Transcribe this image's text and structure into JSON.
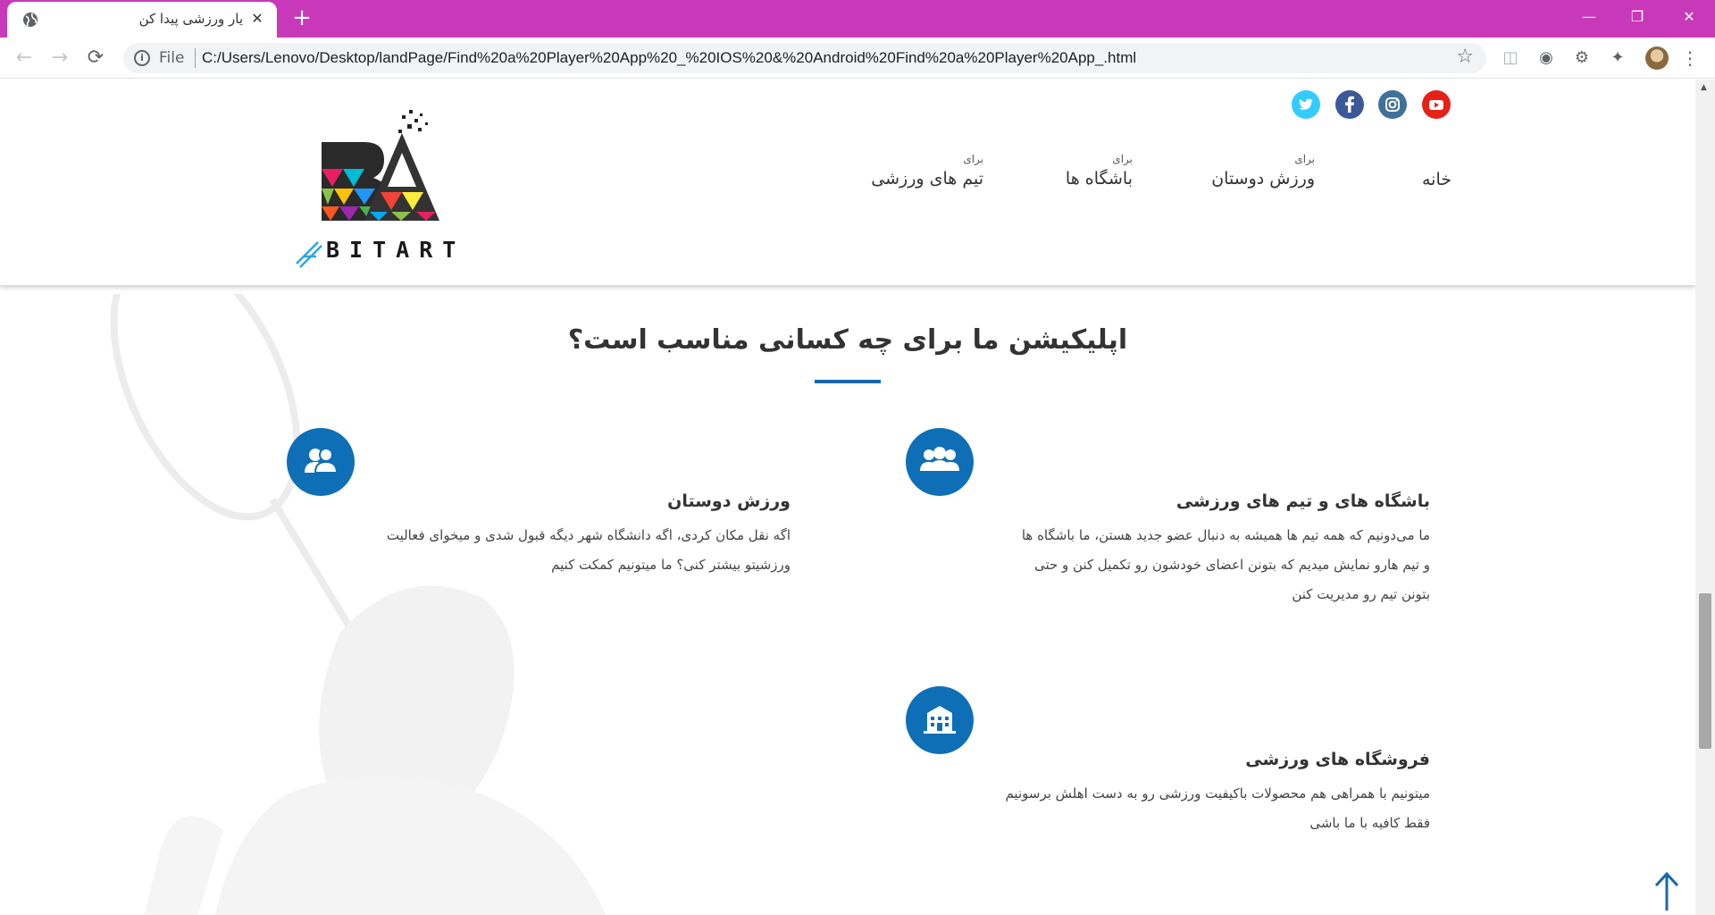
{
  "browser": {
    "tab_title": "یار ورزشی پیدا کن",
    "tab_close": "✕",
    "new_tab": "+",
    "win_minimize": "—",
    "win_restore": "❐",
    "win_close": "✕",
    "back": "←",
    "forward": "→",
    "reload": "⟳",
    "info_glyph": "i",
    "scheme": "File",
    "url": "C:/Users/Lenovo/Desktop/landPage/Find%20a%20Player%20App%20_%20IOS%20&%20Android%20Find%20a%20Player%20App_.html",
    "star": "☆",
    "extensions": [
      "◫",
      "◉",
      "⚙",
      "✦"
    ],
    "menu": "⋮",
    "icons": [
      "globe-icon",
      "info-icon",
      "star-icon",
      "camera-icon",
      "screenshot-icon",
      "extension-icon",
      "puzzle-icon",
      "profile-avatar",
      "kebab-menu-icon"
    ]
  },
  "header": {
    "social": [
      {
        "name": "youtube",
        "color": "#e62117"
      },
      {
        "name": "instagram",
        "color": "#3f729b"
      },
      {
        "name": "facebook",
        "color": "#3b5998"
      },
      {
        "name": "twitter",
        "color": "#33ccff"
      }
    ],
    "nav": [
      {
        "small": "",
        "label": "خانه"
      },
      {
        "small": "برای",
        "label": "ورزش دوستان"
      },
      {
        "small": "برای",
        "label": "باشگاه ها"
      },
      {
        "small": "برای",
        "label": "تیم های ورزشی"
      }
    ],
    "logo_text": "BITART"
  },
  "section": {
    "title": "اپلیکیشن ما برای چه کسانی مناسب است؟",
    "accent_color": "#1766b0"
  },
  "features": [
    {
      "icon": "group-icon",
      "title": "باشگاه های و تیم های ورزشی",
      "lines": [
        "ما می‌دونیم که همه تیم ها همیشه به دنبال عضو جدید هستن، ما باشگاه ها",
        "و تیم هارو نمایش میدیم که بتونن اعضای خودشون رو تکمیل کنن و حتی",
        "بتونن تیم رو مدیریت کنن"
      ]
    },
    {
      "icon": "friends-icon",
      "title": "ورزش دوستان",
      "lines": [
        "اگه نقل مکان کردی، اگه دانشگاه شهر دیگه قبول شدی و میخوای فعالیت",
        "ورزشیتو بیشتر کنی؟ ما میتونیم کمکت کنیم"
      ]
    },
    {
      "icon": "store-icon",
      "title": "فروشگاه های ورزشی",
      "lines": [
        "میتونیم با همراهی هم محصولات باکیفیت ورزشی رو به دست اهلش برسونیم",
        "فقط کافیه با ما باشی"
      ]
    }
  ]
}
